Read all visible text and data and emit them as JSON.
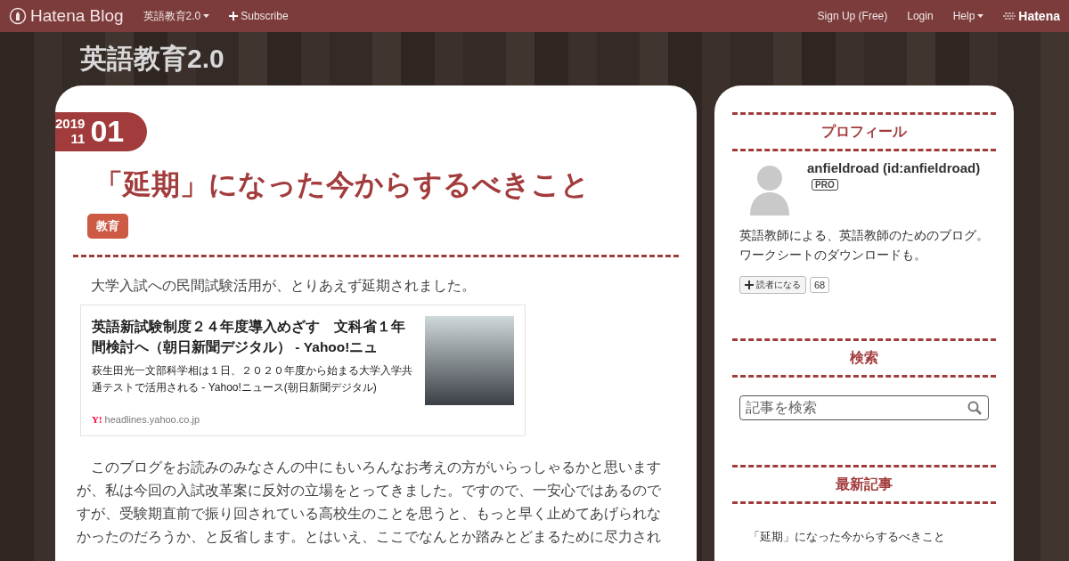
{
  "header": {
    "logo": "Hatena Blog",
    "blog_menu": "英語教育2.0",
    "subscribe": "Subscribe",
    "links": [
      "Sign Up (Free)",
      "Login"
    ],
    "help": "Help",
    "brand": "Hatena"
  },
  "blog_title": "英語教育2.0",
  "entry": {
    "year": "2019",
    "month": "11",
    "day": "01",
    "title": "「延期」になった今からするべきこと",
    "category": "教育",
    "intro": "大学入試への民間試験活用が、とりあえず延期されました。",
    "link_card": {
      "title": "英語新試験制度２４年度導入めざす　文科省１年間検討へ（朝日新聞デジタル） - Yahoo!ニュ",
      "description": "萩生田光一文部科学相は１日、２０２０年度から始まる大学入学共通テストで活用される - Yahoo!ニュース(朝日新聞デジタル)",
      "favicon": "Y!",
      "domain": "headlines.yahoo.co.jp"
    },
    "paragraph": "このブログをお読みのみなさんの中にもいろんなお考えの方がいらっしゃるかと思いますが、私は今回の入試改革案に反対の立場をとってきました。ですので、一安心ではあるのですが、受験期直前で振り回されている高校生のことを思うと、もっと早く止めてあげられなかったのだろうか、と反省します。とはいえ、ここでなんとか踏みとどまるために尽力され"
  },
  "sidebar": {
    "profile": {
      "heading": "プロフィール",
      "name": "anfieldroad (id:anfieldroad)",
      "badge": "PRO",
      "description": "英語教師による、英語教師のためのブログ。ワークシートのダウンロードも。",
      "reader_button": "読者になる",
      "reader_count": "68"
    },
    "search": {
      "heading": "検索",
      "placeholder": "記事を検索"
    },
    "recent": {
      "heading": "最新記事",
      "items": [
        "「延期」になった今からするべきこと"
      ]
    }
  }
}
